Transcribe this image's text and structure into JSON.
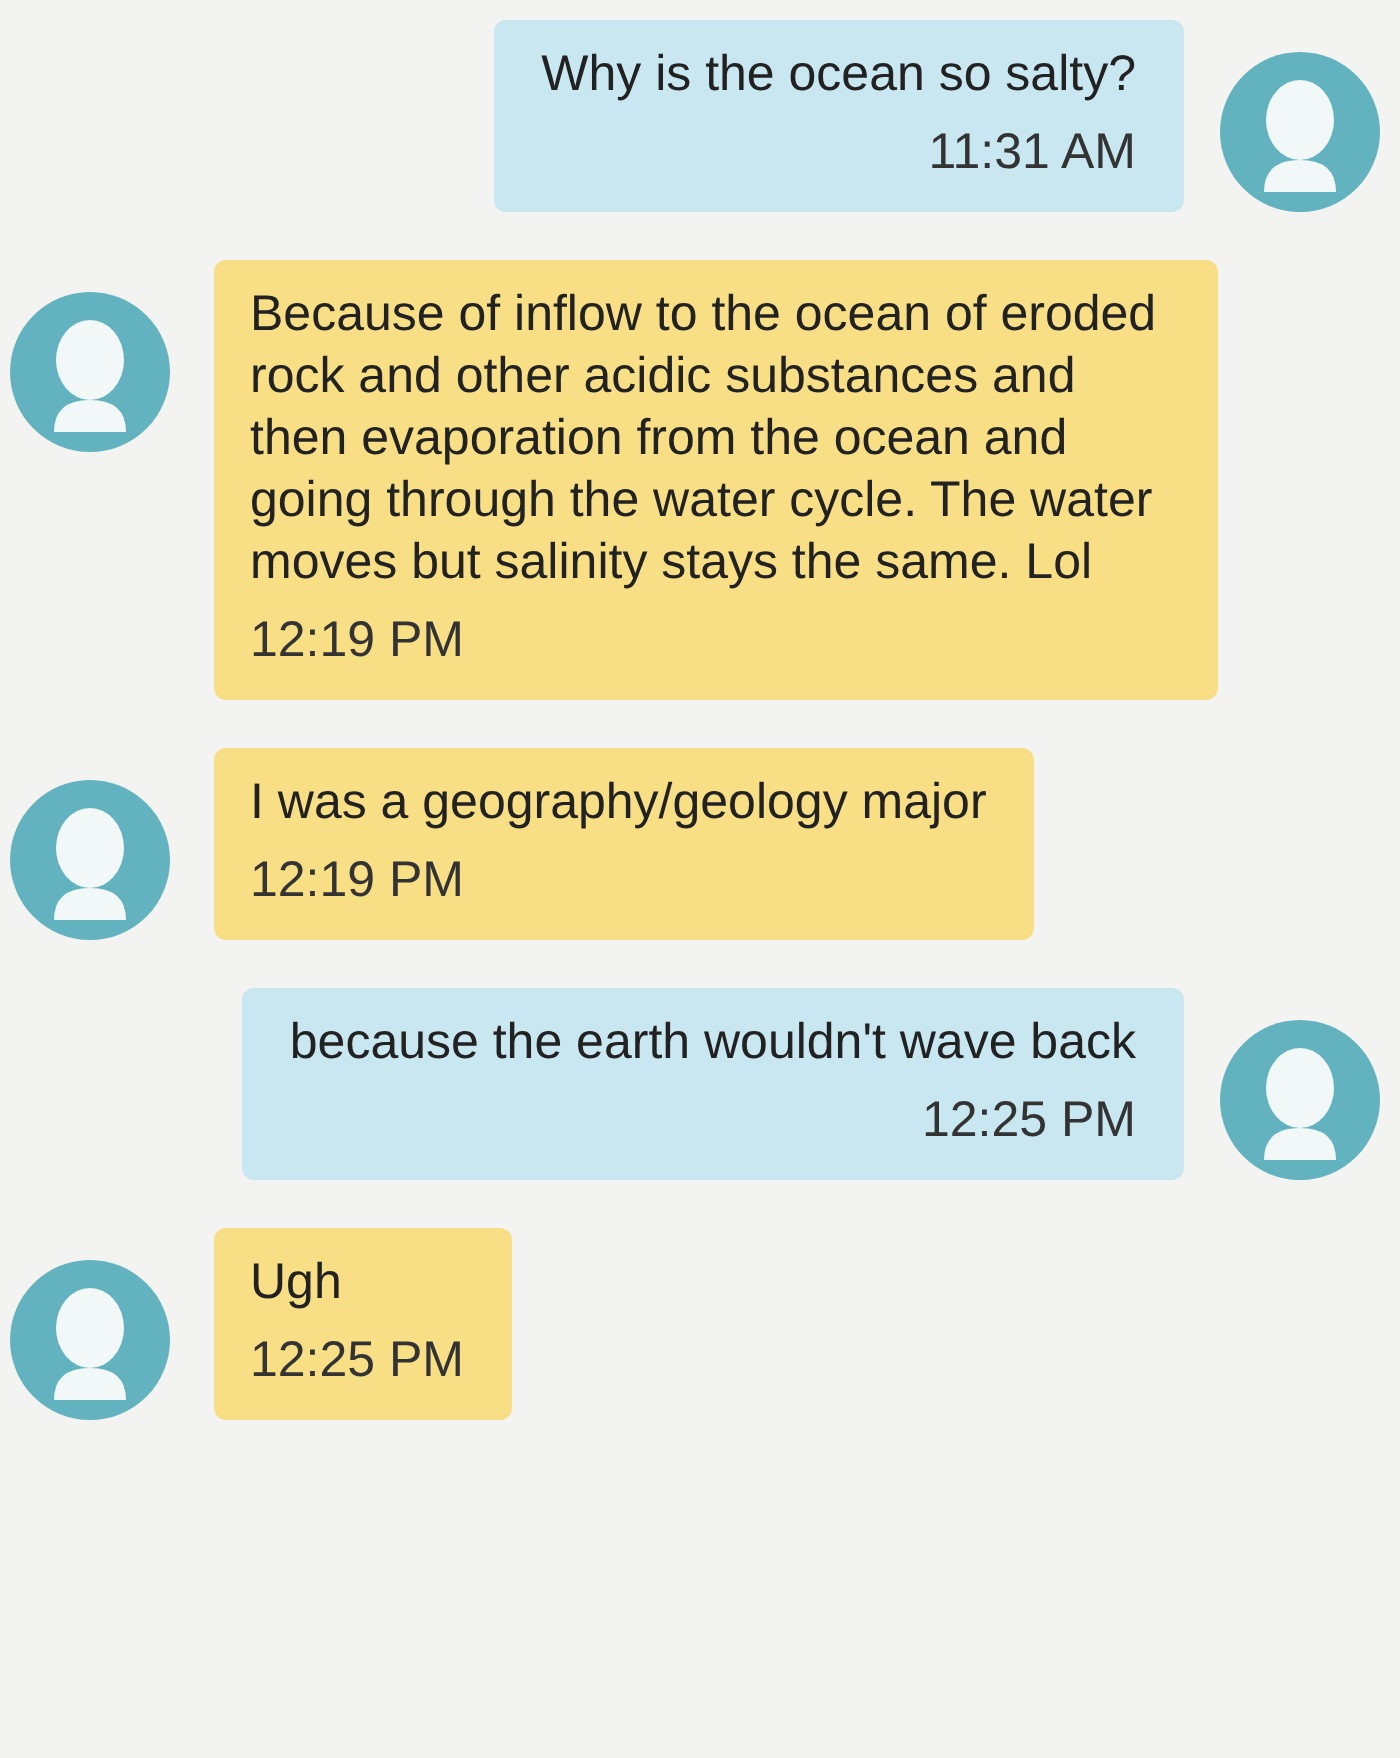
{
  "messages": [
    {
      "kind": "sent",
      "text": "Why is the ocean so salty?",
      "time": "11:31 AM"
    },
    {
      "kind": "received",
      "text": "Because of inflow to the ocean of eroded rock and other acidic substances and then evaporation from the ocean and going through the water cycle. The water moves but salinity stays the same. Lol",
      "time": "12:19 PM"
    },
    {
      "kind": "received",
      "text": "I was a geography/geology major",
      "time": "12:19 PM"
    },
    {
      "kind": "sent",
      "text": "because the earth wouldn't wave back",
      "time": "12:25 PM"
    },
    {
      "kind": "received",
      "text": "Ugh",
      "time": "12:25 PM"
    }
  ]
}
